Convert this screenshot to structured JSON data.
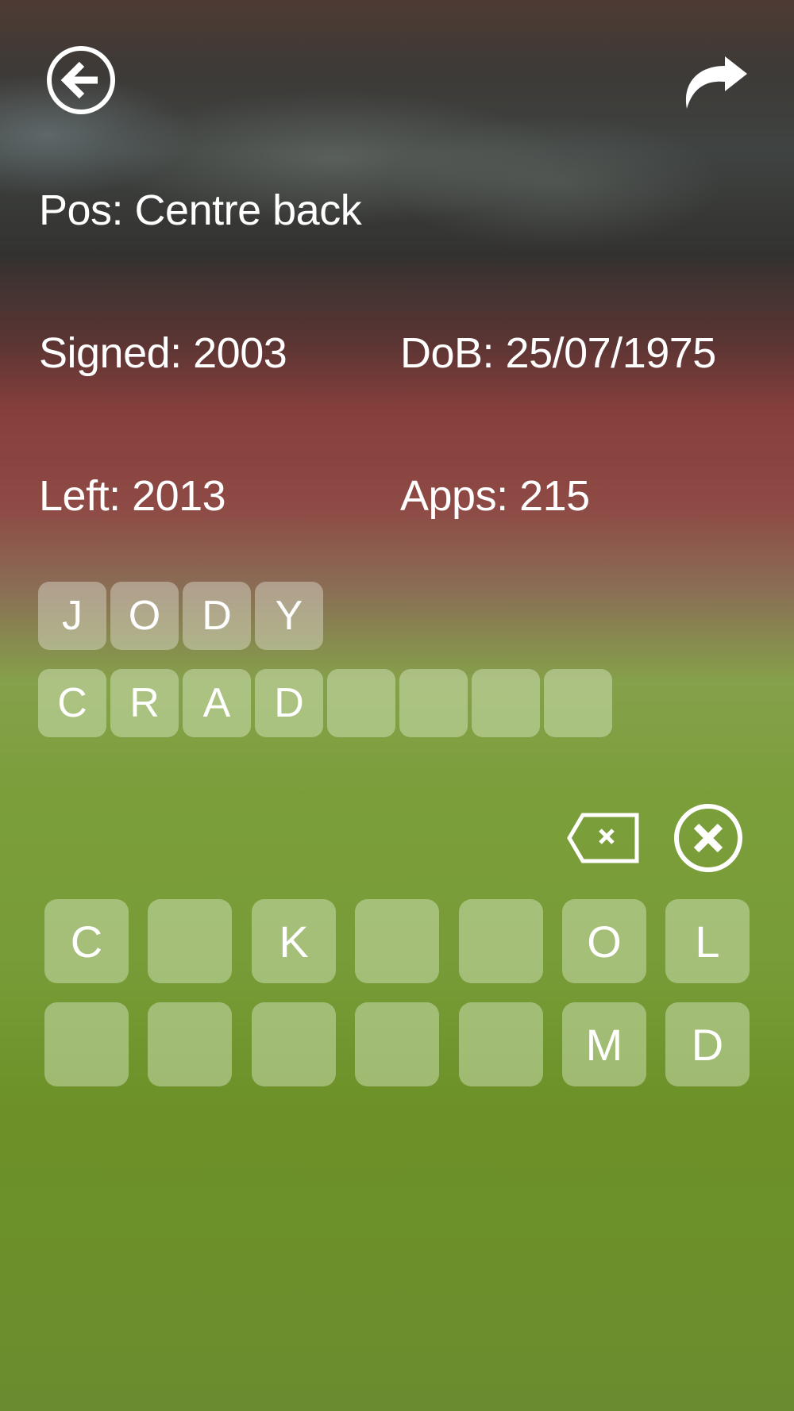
{
  "header": {
    "back_icon": "back-arrow-circle-icon",
    "share_icon": "share-arrow-icon"
  },
  "player": {
    "position": "Pos: Centre back",
    "signed": "Signed: 2003",
    "dob": "DoB: 25/07/1975",
    "left": "Left: 2013",
    "apps": "Apps: 215"
  },
  "answer": {
    "first_name": [
      "J",
      "O",
      "D",
      "Y"
    ],
    "last_name": [
      "C",
      "R",
      "A",
      "D",
      "",
      "",
      "",
      ""
    ]
  },
  "controls": {
    "backspace_icon": "backspace-icon",
    "clear_icon": "clear-circle-icon"
  },
  "keyboard": {
    "row1": [
      "C",
      "",
      "K",
      "",
      "",
      "O",
      "L"
    ],
    "row2": [
      "",
      "",
      "",
      "",
      "",
      "M",
      "D"
    ]
  }
}
